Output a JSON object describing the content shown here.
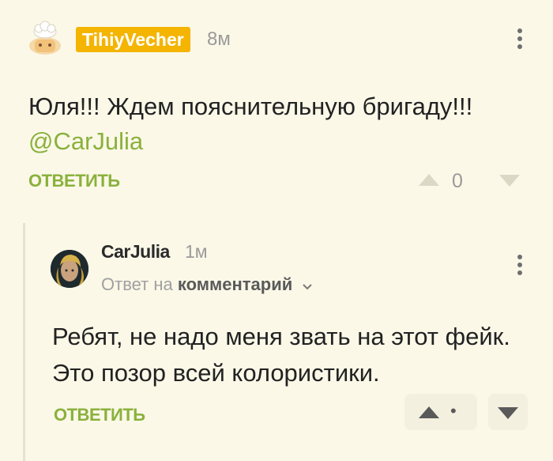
{
  "comment1": {
    "username": "TihiyVecher",
    "time": "8м",
    "text": "Юля!!! Ждем пояснительную бригаду!!!",
    "mention": "@CarJulia",
    "reply_label": "ОТВЕТИТЬ",
    "score": "0"
  },
  "comment2": {
    "username": "CarJulia",
    "time": "1м",
    "reply_to_prefix": "Ответ на",
    "reply_to_link": "комментарий",
    "text": "Ребят, не надо меня звать на этот фейк. Это позор всей колористики.",
    "reply_label": "ОТВЕТИТЬ",
    "score": "•"
  },
  "colors": {
    "background": "#fbf8e8",
    "accent_green": "#8ab13c",
    "badge": "#f4b400",
    "muted": "#9a9a9a"
  },
  "icons": {
    "upvote": "triangle-up-icon",
    "downvote": "triangle-down-icon",
    "menu": "more-vertical-icon",
    "chevron": "chevron-down-icon"
  }
}
